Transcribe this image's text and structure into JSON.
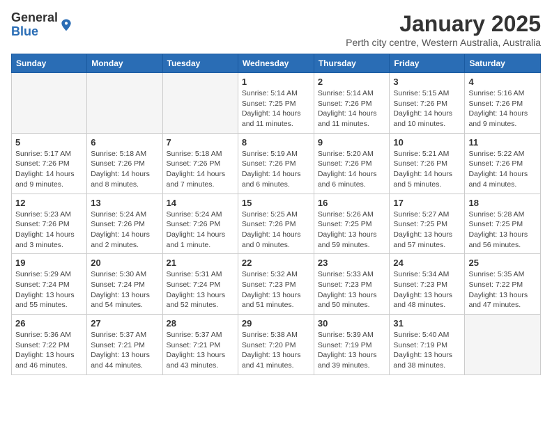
{
  "logo": {
    "general": "General",
    "blue": "Blue"
  },
  "title": "January 2025",
  "subtitle": "Perth city centre, Western Australia, Australia",
  "header": {
    "days": [
      "Sunday",
      "Monday",
      "Tuesday",
      "Wednesday",
      "Thursday",
      "Friday",
      "Saturday"
    ]
  },
  "weeks": [
    [
      {
        "day": "",
        "info": ""
      },
      {
        "day": "",
        "info": ""
      },
      {
        "day": "",
        "info": ""
      },
      {
        "day": "1",
        "info": "Sunrise: 5:14 AM\nSunset: 7:25 PM\nDaylight: 14 hours\nand 11 minutes."
      },
      {
        "day": "2",
        "info": "Sunrise: 5:14 AM\nSunset: 7:26 PM\nDaylight: 14 hours\nand 11 minutes."
      },
      {
        "day": "3",
        "info": "Sunrise: 5:15 AM\nSunset: 7:26 PM\nDaylight: 14 hours\nand 10 minutes."
      },
      {
        "day": "4",
        "info": "Sunrise: 5:16 AM\nSunset: 7:26 PM\nDaylight: 14 hours\nand 9 minutes."
      }
    ],
    [
      {
        "day": "5",
        "info": "Sunrise: 5:17 AM\nSunset: 7:26 PM\nDaylight: 14 hours\nand 9 minutes."
      },
      {
        "day": "6",
        "info": "Sunrise: 5:18 AM\nSunset: 7:26 PM\nDaylight: 14 hours\nand 8 minutes."
      },
      {
        "day": "7",
        "info": "Sunrise: 5:18 AM\nSunset: 7:26 PM\nDaylight: 14 hours\nand 7 minutes."
      },
      {
        "day": "8",
        "info": "Sunrise: 5:19 AM\nSunset: 7:26 PM\nDaylight: 14 hours\nand 6 minutes."
      },
      {
        "day": "9",
        "info": "Sunrise: 5:20 AM\nSunset: 7:26 PM\nDaylight: 14 hours\nand 6 minutes."
      },
      {
        "day": "10",
        "info": "Sunrise: 5:21 AM\nSunset: 7:26 PM\nDaylight: 14 hours\nand 5 minutes."
      },
      {
        "day": "11",
        "info": "Sunrise: 5:22 AM\nSunset: 7:26 PM\nDaylight: 14 hours\nand 4 minutes."
      }
    ],
    [
      {
        "day": "12",
        "info": "Sunrise: 5:23 AM\nSunset: 7:26 PM\nDaylight: 14 hours\nand 3 minutes."
      },
      {
        "day": "13",
        "info": "Sunrise: 5:24 AM\nSunset: 7:26 PM\nDaylight: 14 hours\nand 2 minutes."
      },
      {
        "day": "14",
        "info": "Sunrise: 5:24 AM\nSunset: 7:26 PM\nDaylight: 14 hours\nand 1 minute."
      },
      {
        "day": "15",
        "info": "Sunrise: 5:25 AM\nSunset: 7:26 PM\nDaylight: 14 hours\nand 0 minutes."
      },
      {
        "day": "16",
        "info": "Sunrise: 5:26 AM\nSunset: 7:25 PM\nDaylight: 13 hours\nand 59 minutes."
      },
      {
        "day": "17",
        "info": "Sunrise: 5:27 AM\nSunset: 7:25 PM\nDaylight: 13 hours\nand 57 minutes."
      },
      {
        "day": "18",
        "info": "Sunrise: 5:28 AM\nSunset: 7:25 PM\nDaylight: 13 hours\nand 56 minutes."
      }
    ],
    [
      {
        "day": "19",
        "info": "Sunrise: 5:29 AM\nSunset: 7:24 PM\nDaylight: 13 hours\nand 55 minutes."
      },
      {
        "day": "20",
        "info": "Sunrise: 5:30 AM\nSunset: 7:24 PM\nDaylight: 13 hours\nand 54 minutes."
      },
      {
        "day": "21",
        "info": "Sunrise: 5:31 AM\nSunset: 7:24 PM\nDaylight: 13 hours\nand 52 minutes."
      },
      {
        "day": "22",
        "info": "Sunrise: 5:32 AM\nSunset: 7:23 PM\nDaylight: 13 hours\nand 51 minutes."
      },
      {
        "day": "23",
        "info": "Sunrise: 5:33 AM\nSunset: 7:23 PM\nDaylight: 13 hours\nand 50 minutes."
      },
      {
        "day": "24",
        "info": "Sunrise: 5:34 AM\nSunset: 7:23 PM\nDaylight: 13 hours\nand 48 minutes."
      },
      {
        "day": "25",
        "info": "Sunrise: 5:35 AM\nSunset: 7:22 PM\nDaylight: 13 hours\nand 47 minutes."
      }
    ],
    [
      {
        "day": "26",
        "info": "Sunrise: 5:36 AM\nSunset: 7:22 PM\nDaylight: 13 hours\nand 46 minutes."
      },
      {
        "day": "27",
        "info": "Sunrise: 5:37 AM\nSunset: 7:21 PM\nDaylight: 13 hours\nand 44 minutes."
      },
      {
        "day": "28",
        "info": "Sunrise: 5:37 AM\nSunset: 7:21 PM\nDaylight: 13 hours\nand 43 minutes."
      },
      {
        "day": "29",
        "info": "Sunrise: 5:38 AM\nSunset: 7:20 PM\nDaylight: 13 hours\nand 41 minutes."
      },
      {
        "day": "30",
        "info": "Sunrise: 5:39 AM\nSunset: 7:19 PM\nDaylight: 13 hours\nand 39 minutes."
      },
      {
        "day": "31",
        "info": "Sunrise: 5:40 AM\nSunset: 7:19 PM\nDaylight: 13 hours\nand 38 minutes."
      },
      {
        "day": "",
        "info": ""
      }
    ]
  ]
}
